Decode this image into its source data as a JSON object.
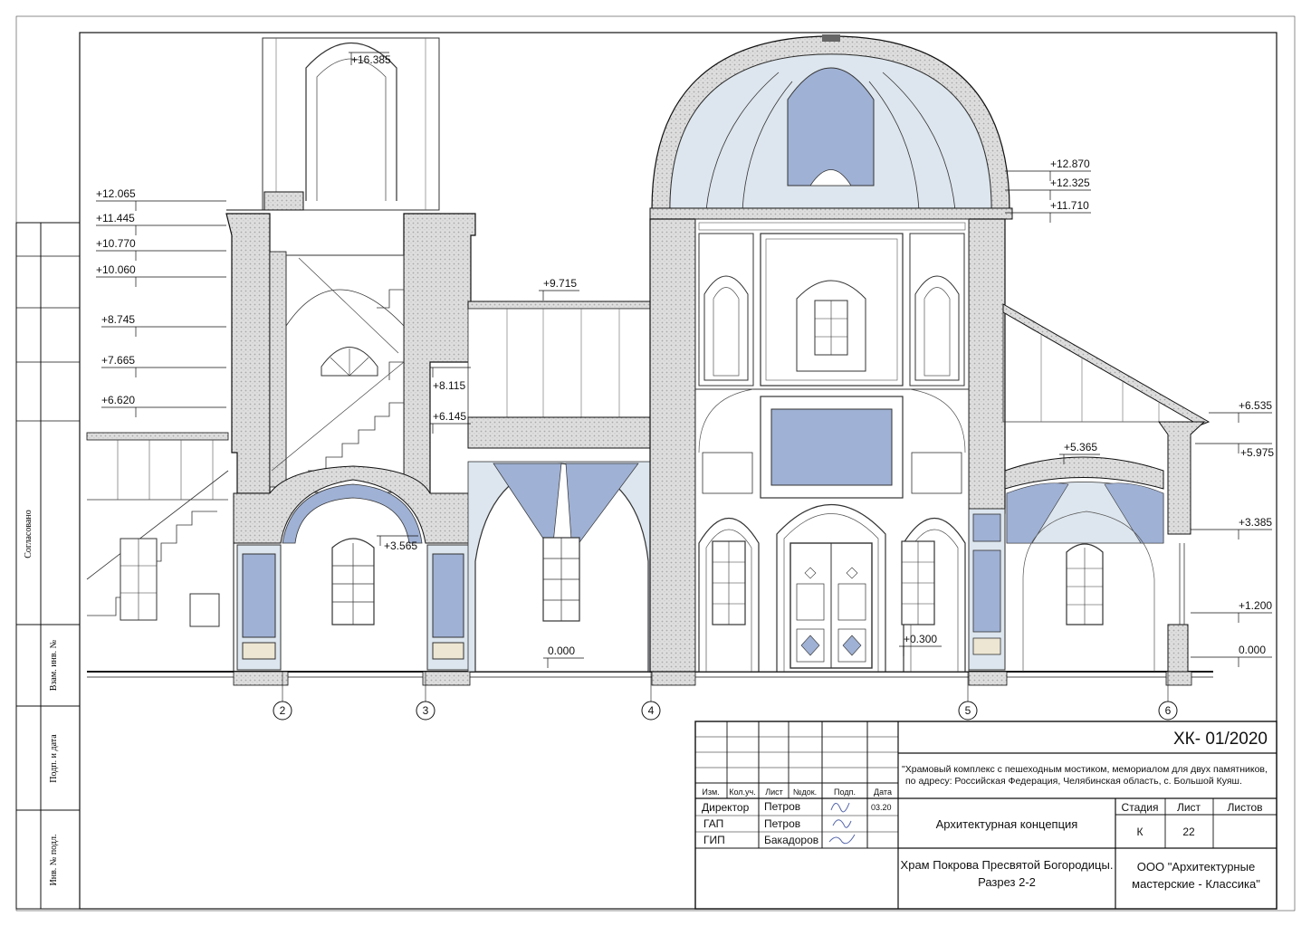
{
  "drawing": {
    "elevation_marks_left": [
      "+12.065",
      "+11.445",
      "+10.770",
      "+10.060",
      "+8.745",
      "+7.665",
      "+6.620"
    ],
    "elevation_marks_right": [
      "+12.870",
      "+12.325",
      "+11.710",
      "+6.535",
      "+5.975",
      "+3.385",
      "+1.200",
      "0.000"
    ],
    "elevation_marks_inner": {
      "top": "+16.385",
      "roof": "+9.715",
      "stair_upper": "+8.115",
      "stair_lower": "+6.145",
      "arch": "+3.565",
      "floor": "0.000",
      "solea": "+0.300",
      "right_vault": "+5.365"
    },
    "axes": [
      "2",
      "3",
      "4",
      "5",
      "6"
    ],
    "colors": {
      "line": "#1a1a1a",
      "vault_blue": "#9fb1d4",
      "vault_light": "#dde6ee",
      "wall_hatch": "#cfcfcf",
      "plinth": "#ece6d2"
    }
  },
  "side_stamp": {
    "labels": [
      "Согласовано",
      "Взам. инв. №",
      "Подп. и дата",
      "Инв. № подл."
    ]
  },
  "title_block": {
    "code": "ХК- 01/2020",
    "project_line1": "\"Храмовый комплекс с пешеходным мостиком, мемориалом для двух памятников,",
    "project_line2": "по адресу: Российская Федерация, Челябинская область, с. Большой Куяш.",
    "headers": [
      "Изм.",
      "Кол.уч.",
      "Лист",
      "№док.",
      "Подп.",
      "Дата"
    ],
    "roles": [
      {
        "role": "Директор",
        "name": "Петров",
        "date": "03.20"
      },
      {
        "role": "ГАП",
        "name": "Петров",
        "date": ""
      },
      {
        "role": "ГИП",
        "name": "Бакадоров",
        "date": ""
      }
    ],
    "stage_name": "Архитектурная концепция",
    "stage_headers": [
      "Стадия",
      "Лист",
      "Листов"
    ],
    "stage_values": [
      "К",
      "22",
      ""
    ],
    "sheet_title_line1": "Храм Покрова Пресвятой Богородицы.",
    "sheet_title_line2": "Разрез 2-2",
    "org_line1": "ООО \"Архитектурные",
    "org_line2": "мастерские - Классика\""
  }
}
